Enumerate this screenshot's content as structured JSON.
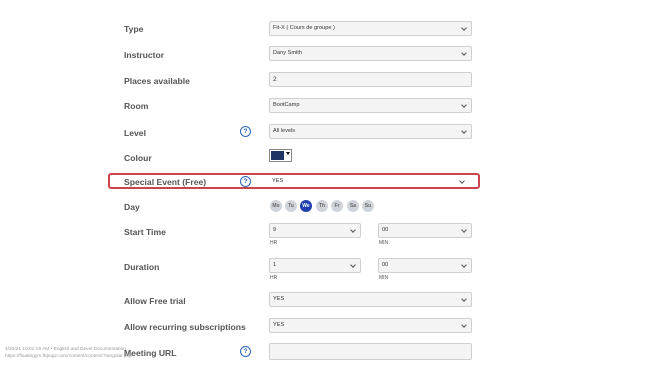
{
  "form": {
    "type": {
      "label": "Type",
      "value": "Fit-X ( Cours de groupe )"
    },
    "instructor": {
      "label": "Instructor",
      "value": "Dany Smith"
    },
    "places": {
      "label": "Places available",
      "value": "2"
    },
    "room": {
      "label": "Room",
      "value": "BootCamp"
    },
    "level": {
      "label": "Level",
      "value": "All levels",
      "help": "?"
    },
    "colour": {
      "label": "Colour",
      "swatch": "#1f3565"
    },
    "special_event": {
      "label": "Special Event (Free)",
      "value": "YES",
      "help": "?"
    },
    "day": {
      "label": "Day",
      "options": [
        "Mo",
        "Tu",
        "We",
        "Th",
        "Fr",
        "Sa",
        "Su"
      ],
      "selected": "We"
    },
    "start_time": {
      "label": "Start Time",
      "hr_value": "9",
      "min_value": "00",
      "hr_unit": "HR",
      "min_unit": "MIN"
    },
    "duration": {
      "label": "Duration",
      "hr_value": "1",
      "min_value": "00",
      "hr_unit": "HR",
      "min_unit": "MIN"
    },
    "free_trial": {
      "label": "Allow Free trial",
      "value": "YES"
    },
    "recurring": {
      "label": "Allow recurring subscriptions",
      "value": "YES"
    },
    "meeting_url": {
      "label": "Meeting URL",
      "value": "",
      "help": "?"
    }
  },
  "footer": {
    "line1": "4/20/21 10:01:19 AM • English and Devel Documentation",
    "line2": "https://floatingym.ft/pugz.com/content/content/?tangolar.php"
  },
  "colors": {
    "accent": "#1f3fb0",
    "highlight_border": "#c9444b",
    "help_icon": "#2b66b8"
  }
}
